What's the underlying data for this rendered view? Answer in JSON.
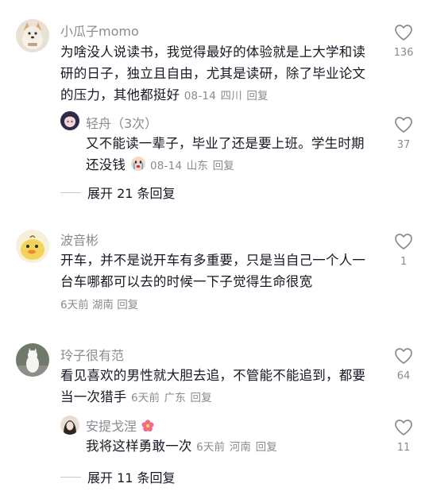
{
  "comments": [
    {
      "username": "小瓜子momo",
      "text": "为啥没人说读书，我觉得最好的体验就是上大学和读研的日子，独立且自由，尤其是读研，除了毕业论文的压力，其他都挺好",
      "time": "08-14",
      "location": "四川",
      "reply_label": "回复",
      "likes": "136",
      "avatar_icon": "dog-avatar",
      "replies": [
        {
          "username": "轻舟（3次）",
          "text": "又不能读一辈子，毕业了还是要上班。学生时期还没钱",
          "emoji": "crying-face-emoji",
          "time": "08-14",
          "location": "山东",
          "reply_label": "回复",
          "likes": "37"
        }
      ],
      "expand_label": "展开 21 条回复"
    },
    {
      "username": "波音彬",
      "text": "开车，并不是说开车有多重要，只是当自己一个人一台车哪都可以去的时候一下子觉得生命很宽",
      "time": "6天前",
      "location": "湖南",
      "reply_label": "回复",
      "likes": "1",
      "avatar_icon": "duck-avatar"
    },
    {
      "username": "玲子很有范",
      "text": "看见喜欢的男性就大胆去追，不管能不能追到，都要当一次猎手",
      "time": "6天前",
      "location": "广东",
      "reply_label": "回复",
      "likes": "64",
      "avatar_icon": "cat-avatar",
      "replies": [
        {
          "username": "安提戈涅",
          "text": "我将这样勇敢一次",
          "emoji": "flower-emoji",
          "time": "6天前",
          "location": "河南",
          "reply_label": "回复",
          "likes": "11"
        }
      ],
      "expand_label": "展开 11 条回复"
    }
  ]
}
